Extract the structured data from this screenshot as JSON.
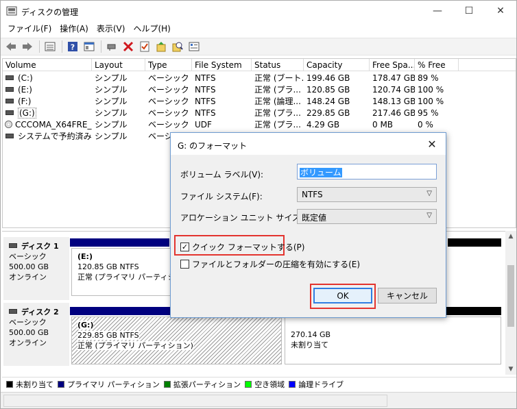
{
  "window": {
    "title": "ディスクの管理",
    "min_glyph": "—",
    "max_glyph": "☐",
    "close_glyph": "✕"
  },
  "menu": [
    "ファイル(F)",
    "操作(A)",
    "表示(V)",
    "ヘルプ(H)"
  ],
  "toolbar_icons": [
    "back-icon",
    "forward-icon",
    "volume-list-icon",
    "help-icon",
    "properties-icon",
    "connect-icon",
    "delete-icon",
    "check-icon",
    "import-icon",
    "search-icon",
    "settings-icon"
  ],
  "volume_table": {
    "headers": [
      "Volume",
      "Layout",
      "Type",
      "File System",
      "Status",
      "Capacity",
      "Free Spa...",
      "% Free"
    ],
    "rows": [
      {
        "volume": "(C:)",
        "layout": "シンプル",
        "type": "ベーシック",
        "fs": "NTFS",
        "status": "正常 (ブート...",
        "capacity": "199.46 GB",
        "free": "178.47 GB",
        "pct": "89 %"
      },
      {
        "volume": "(E:)",
        "layout": "シンプル",
        "type": "ベーシック",
        "fs": "NTFS",
        "status": "正常 (プラ...",
        "capacity": "120.85 GB",
        "free": "120.74 GB",
        "pct": "100 %"
      },
      {
        "volume": "(F:)",
        "layout": "シンプル",
        "type": "ベーシック",
        "fs": "NTFS",
        "status": "正常 (論理...",
        "capacity": "148.24 GB",
        "free": "148.13 GB",
        "pct": "100 %"
      },
      {
        "volume": "(G:)",
        "layout": "シンプル",
        "type": "ベーシック",
        "fs": "NTFS",
        "status": "正常 (プラ...",
        "capacity": "229.85 GB",
        "free": "217.46 GB",
        "pct": "95 %"
      },
      {
        "volume": "CCCOMA_X64FRE_...",
        "layout": "シンプル",
        "type": "ベーシック",
        "fs": "UDF",
        "status": "正常 (プラ...",
        "capacity": "4.29 GB",
        "free": "0 MB",
        "pct": "0 %"
      },
      {
        "volume": "システムで予約済み",
        "layout": "シンプル",
        "type": "ベーシ",
        "fs": "",
        "status": "",
        "capacity": "",
        "free": "",
        "pct": ""
      }
    ]
  },
  "disks": [
    {
      "name": "ディスク 1",
      "type": "ベーシック",
      "size": "500.00 GB",
      "state": "オンライン",
      "part1": {
        "name": "(E:)",
        "size": "120.85 GB NTFS",
        "status": "正常 (プライマリ パーティション)"
      }
    },
    {
      "name": "ディスク 2",
      "type": "ベーシック",
      "size": "500.00 GB",
      "state": "オンライン",
      "part1": {
        "name": "(G:)",
        "size": "229.85 GB NTFS",
        "status": "正常 (プライマリ パーティション)"
      },
      "part2": {
        "size": "270.14 GB",
        "status": "未割り当て"
      }
    }
  ],
  "legend": [
    {
      "label": "未割り当て",
      "color": "#000000"
    },
    {
      "label": "プライマリ パーティション",
      "color": "#00007f"
    },
    {
      "label": "拡張パーティション",
      "color": "#008000"
    },
    {
      "label": "空き領域",
      "color": "#00ff00"
    },
    {
      "label": "論理ドライブ",
      "color": "#0000ff"
    }
  ],
  "dialog": {
    "title": "G: のフォーマット",
    "volume_label_caption": "ボリューム ラベル(V):",
    "volume_label_value": "ボリューム",
    "fs_caption": "ファイル システム(F):",
    "fs_value": "NTFS",
    "alloc_caption": "アロケーション ユニット サイズ(A):",
    "alloc_value": "既定値",
    "quick_format_label": "クイック フォーマットする(P)",
    "quick_format_checked": true,
    "compress_label": "ファイルとフォルダーの圧縮を有効にする(E)",
    "compress_checked": false,
    "ok_label": "OK",
    "cancel_label": "キャンセル",
    "highlight_color": "#e3332e"
  }
}
